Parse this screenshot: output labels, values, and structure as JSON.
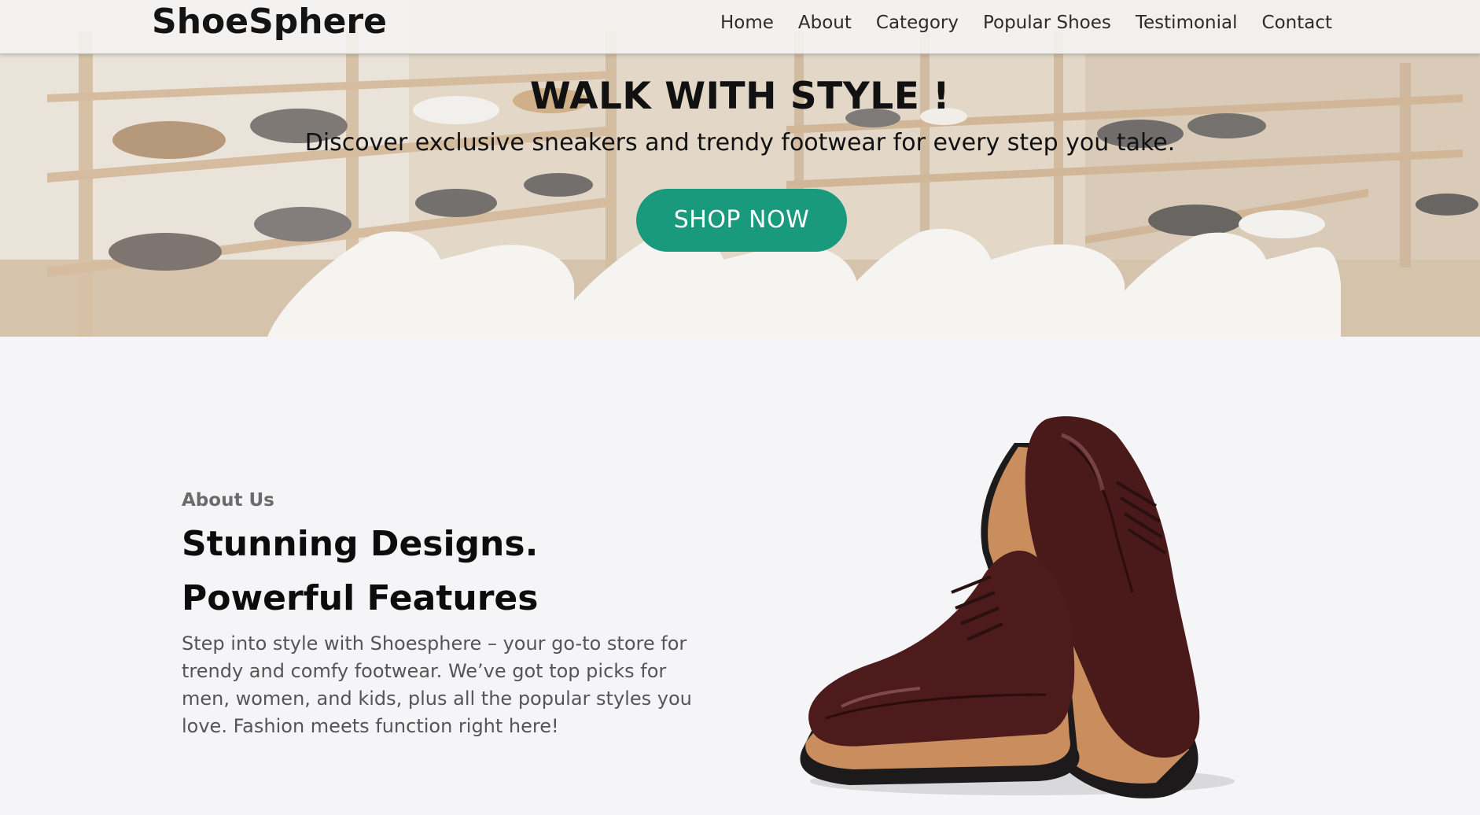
{
  "nav": {
    "brand": "ShoeSphere",
    "links": [
      "Home",
      "About",
      "Category",
      "Popular Shoes",
      "Testimonial",
      "Contact"
    ]
  },
  "hero": {
    "title": "WALK WITH STYLE !",
    "subtitle": "Discover exclusive sneakers and trendy footwear for every step you take.",
    "cta_label": "SHOP NOW"
  },
  "about": {
    "eyebrow": "About Us",
    "heading_line1": "Stunning Designs.",
    "heading_line2": "Powerful Features",
    "body": "Step into style with Shoesphere – your go-to store for trendy and comfy footwear. We’ve got top picks for men, women, and kids, plus all the popular styles you love. Fashion meets function right here!"
  },
  "colors": {
    "accent": "#1a9a7c",
    "page_bg": "#f5f5f7",
    "heading": "#0c0c0c",
    "body_text": "#555555"
  },
  "images": {
    "hero_background": "shoe-store-shelves-with-white-sneakers",
    "about_image": "pair-of-burgundy-leather-derby-shoes"
  }
}
